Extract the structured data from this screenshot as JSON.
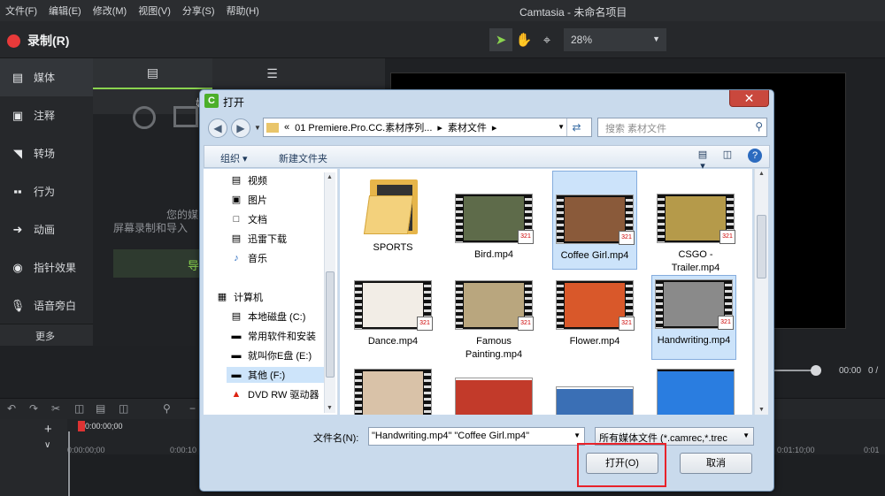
{
  "menu": [
    "文件(F)",
    "编辑(E)",
    "修改(M)",
    "视图(V)",
    "分享(S)",
    "帮助(H)"
  ],
  "app_title": "Camtasia - 未命名项目",
  "record_label": "录制(R)",
  "zoom": "28%",
  "sidebar": {
    "items": [
      {
        "icon": "film-icon",
        "label": "媒体"
      },
      {
        "icon": "annotation-icon",
        "label": "注释"
      },
      {
        "icon": "transition-icon",
        "label": "转场"
      },
      {
        "icon": "behavior-icon",
        "label": "行为"
      },
      {
        "icon": "animation-icon",
        "label": "动画"
      },
      {
        "icon": "cursor-effect-icon",
        "label": "指针效果"
      },
      {
        "icon": "microphone-icon",
        "label": "语音旁白"
      }
    ],
    "more": "更多"
  },
  "panel": {
    "header": "媒",
    "empty_line1": "您的媒",
    "empty_line2": "屏幕录制和导入",
    "import_label": "导"
  },
  "player": {
    "time_current": "00:00",
    "time_sep": "0 /"
  },
  "timeline": {
    "playhead": "0:00:00;00",
    "ticks": [
      "0:00:00;00",
      "0:00:10",
      "0:01:10;00",
      "0:01"
    ]
  },
  "dialog": {
    "title": "打开",
    "address": [
      "«",
      "01 Premiere.Pro.CC.素材序列...",
      "▸",
      "素材文件",
      "▸"
    ],
    "search_placeholder": "搜索 素材文件",
    "organize": "组织 ▾",
    "new_folder": "新建文件夹",
    "nav": [
      {
        "icon": "video-library-icon",
        "label": "视频"
      },
      {
        "icon": "picture-library-icon",
        "label": "图片"
      },
      {
        "icon": "document-library-icon",
        "label": "文档"
      },
      {
        "icon": "thunder-download-icon",
        "label": "迅雷下载"
      },
      {
        "icon": "music-library-icon",
        "label": "音乐"
      },
      {
        "icon": "computer-icon",
        "label": "计算机"
      },
      {
        "icon": "local-disk-icon",
        "label": "本地磁盘 (C:)"
      },
      {
        "icon": "drive-icon",
        "label": "常用软件和安装"
      },
      {
        "icon": "drive-icon",
        "label": "就叫你E盘 (E:)"
      },
      {
        "icon": "drive-icon",
        "label": "其他 (F:)"
      },
      {
        "icon": "dvd-drive-icon",
        "label": "DVD RW 驱动器"
      }
    ],
    "files": [
      {
        "name": "SPORTS",
        "kind": "folder",
        "selected": false
      },
      {
        "name": "Bird.mp4",
        "kind": "video",
        "selected": false,
        "color": "#5e6b4a"
      },
      {
        "name": "Coffee Girl.mp4",
        "kind": "video",
        "selected": true,
        "color": "#8a5a3a"
      },
      {
        "name": "CSGO - Trailer.mp4",
        "kind": "video",
        "selected": false,
        "color": "#b59a4a"
      },
      {
        "name": "Dance.mp4",
        "kind": "video",
        "selected": false,
        "color": "#f2ede6"
      },
      {
        "name": "Famous Painting.mp4",
        "kind": "video",
        "selected": false,
        "color": "#b9a67e"
      },
      {
        "name": "Flower.mp4",
        "kind": "video",
        "selected": false,
        "color": "#d9582a"
      },
      {
        "name": "Handwriting.mp4",
        "kind": "video",
        "selected": true,
        "color": "#8a8a8a"
      },
      {
        "name": "",
        "kind": "video",
        "selected": false,
        "color": "#d9c2a8"
      },
      {
        "name": "",
        "kind": "video",
        "selected": false,
        "color": "#c23a2a"
      },
      {
        "name": "",
        "kind": "video",
        "selected": false,
        "color": "#3a6fb5"
      },
      {
        "name": "",
        "kind": "video",
        "selected": false,
        "color": "#2a7de0"
      }
    ],
    "filename_label": "文件名(N):",
    "filename_value": "\"Handwriting.mp4\" \"Coffee Girl.mp4\"",
    "filetype": "所有媒体文件 (*.camrec,*.trec",
    "open_button": "打开(O)",
    "cancel_button": "取消"
  },
  "highlight_color": "#e8222a"
}
